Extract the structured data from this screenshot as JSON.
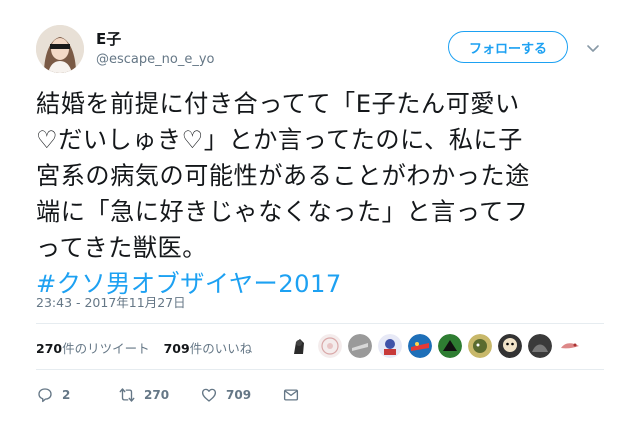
{
  "user": {
    "name": "E子",
    "handle": "@escape_no_e_yo"
  },
  "follow_button": {
    "label": "フォローする"
  },
  "tweet": {
    "lines": [
      "結婚を前提に付き合ってて「E子たん可愛い",
      "♡だいしゅき♡」とか言ってたのに、私に子",
      "宮系の病気の可能性があることがわかった途",
      "端に「急に好きじゃなくなった」と言ってフ",
      "ってきた獣医。"
    ],
    "hashtag": "#クソ男オブザイヤー2017"
  },
  "timestamp": "23:43 - 2017年11月27日",
  "stats": {
    "retweets_count": "270",
    "retweets_label": "件のリツイート",
    "likes_count": "709",
    "likes_label": "件のいいね"
  },
  "actions": {
    "reply_count": "2",
    "retweet_count": "270",
    "like_count": "709"
  },
  "icons": {
    "chevron": "chevron-down-icon",
    "reply": "reply-icon",
    "retweet": "retweet-icon",
    "like": "heart-icon",
    "dm": "envelope-icon"
  },
  "colors": {
    "accent": "#1da1f2",
    "secondary_text": "#657786",
    "primary_text": "#14171a"
  }
}
